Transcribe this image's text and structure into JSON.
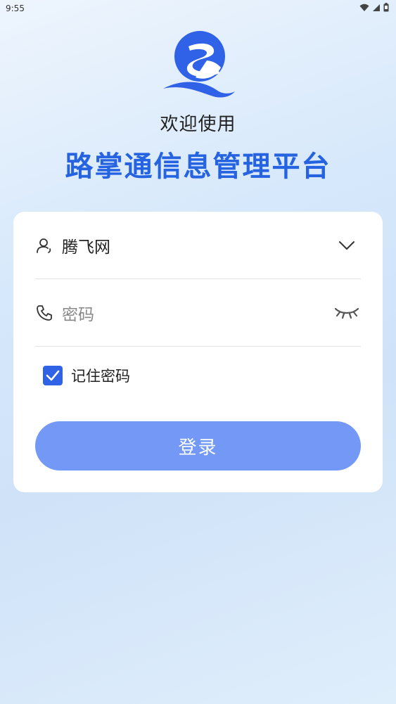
{
  "status_bar": {
    "time": "9:55",
    "icons": [
      "wifi-icon",
      "signal-icon",
      "battery-icon"
    ]
  },
  "header": {
    "logo": "app-logo",
    "welcome": "欢迎使用",
    "title": "路掌通信息管理平台"
  },
  "form": {
    "account": {
      "icon": "user-icon",
      "value": "腾飞网",
      "trailing_icon": "chevron-down-icon"
    },
    "password": {
      "icon": "phone-icon",
      "placeholder": "密码",
      "trailing_icon": "eye-closed-icon"
    },
    "remember": {
      "label": "记住密码",
      "checked": true
    },
    "login_label": "登录"
  },
  "colors": {
    "accent": "#2563e0",
    "checkbox": "#2f62e6",
    "button": "#7398f6"
  }
}
